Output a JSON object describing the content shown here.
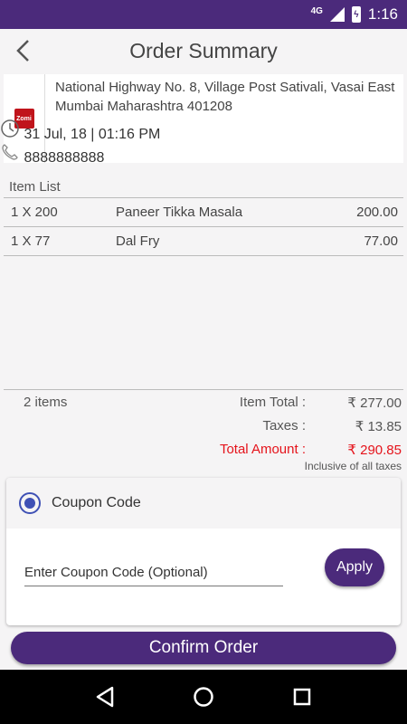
{
  "status_bar": {
    "network": "4G",
    "battery_icon": "battery-charging-icon",
    "time": "1:16"
  },
  "header": {
    "title": "Order Summary",
    "back_icon": "arrow-back-icon"
  },
  "address": {
    "logo_text": "Zomi",
    "text": "National Highway No. 8, Village Post Sativali, Vasai East Mumbai Maharashtra 401208",
    "datetime": "31 Jul, 18 | 01:16 PM",
    "phone": "8888888888"
  },
  "item_list": {
    "label": "Item List",
    "items": [
      {
        "qty": "1 X 200",
        "name": "Paneer Tikka Masala",
        "price": "200.00"
      },
      {
        "qty": "1 X 77",
        "name": "Dal Fry",
        "price": "77.00"
      }
    ]
  },
  "totals": {
    "count": "2 items",
    "item_total_label": "Item Total  :",
    "item_total_value": "₹ 277.00",
    "taxes_label": "Taxes    :",
    "taxes_value": "₹ 13.85",
    "total_label": "Total Amount  :",
    "total_value": "₹ 290.85",
    "note": "Inclusive of all taxes",
    "accent_color": "#e5131b"
  },
  "coupon": {
    "label": "Coupon Code",
    "placeholder": "Enter Coupon Code (Optional)",
    "apply_label": "Apply"
  },
  "confirm_label": "Confirm Order",
  "colors": {
    "primary": "#4b2a7b",
    "radio": "#3f51b5"
  }
}
